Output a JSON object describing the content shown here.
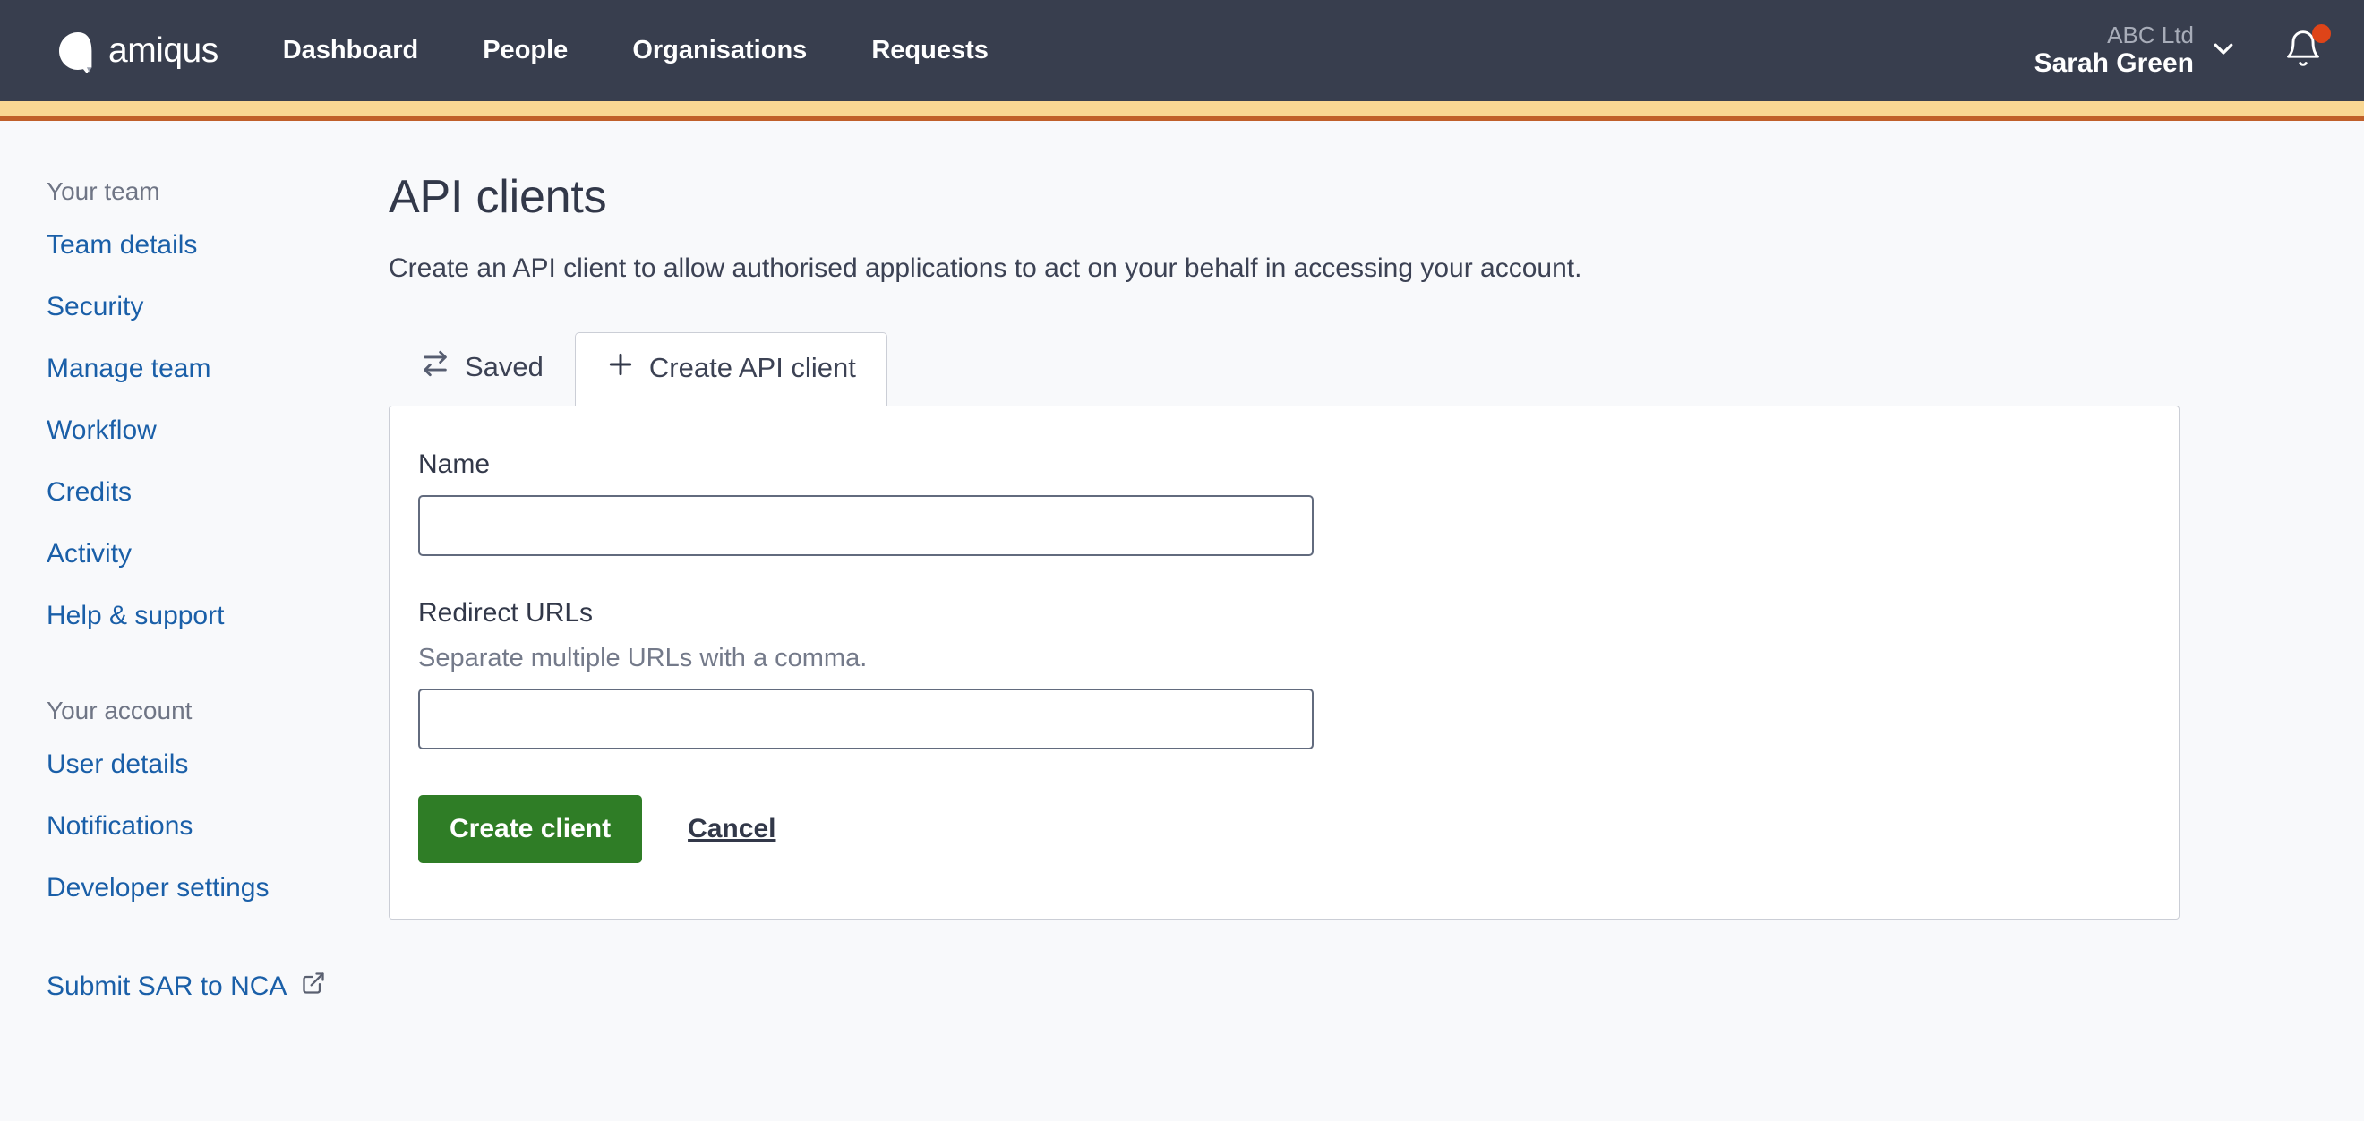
{
  "navbar": {
    "brand": {
      "word": "amiqus",
      "icon": "amiqus-logo-icon"
    },
    "links": [
      {
        "label": "Dashboard"
      },
      {
        "label": "People"
      },
      {
        "label": "Organisations"
      },
      {
        "label": "Requests"
      }
    ],
    "account": {
      "org": "ABC Ltd",
      "user": "Sarah Green",
      "chevron_icon": "chevron-down-icon"
    },
    "notifications": {
      "icon": "bell-icon",
      "has_unread": true,
      "dot_color": "#de4418"
    }
  },
  "accent": {
    "tan_color": "#f9d793",
    "orange_color": "#c0602a"
  },
  "sidebar": {
    "group_team_label": "Your team",
    "team_items": [
      {
        "label": "Team details"
      },
      {
        "label": "Security"
      },
      {
        "label": "Manage team"
      },
      {
        "label": "Workflow"
      },
      {
        "label": "Credits"
      },
      {
        "label": "Activity"
      },
      {
        "label": "Help & support"
      }
    ],
    "group_account_label": "Your account",
    "account_items": [
      {
        "label": "User details"
      },
      {
        "label": "Notifications"
      },
      {
        "label": "Developer settings"
      }
    ],
    "external_link": {
      "label": "Submit SAR to NCA",
      "icon": "external-link-icon"
    }
  },
  "main": {
    "title": "API clients",
    "subtitle": "Create an API client to allow authorised applications to act on your behalf in accessing your account.",
    "tabs": [
      {
        "label": "Saved",
        "icon": "transfer-arrows-icon",
        "active": false
      },
      {
        "label": "Create API client",
        "icon": "plus-icon",
        "active": true
      }
    ],
    "form": {
      "name_field": {
        "label": "Name",
        "value": "",
        "placeholder": ""
      },
      "redirect_field": {
        "label": "Redirect URLs",
        "hint": "Separate multiple URLs with a comma.",
        "value": "",
        "placeholder": ""
      },
      "submit_label": "Create client",
      "cancel_label": "Cancel",
      "submit_color": "#2f7d26"
    }
  }
}
